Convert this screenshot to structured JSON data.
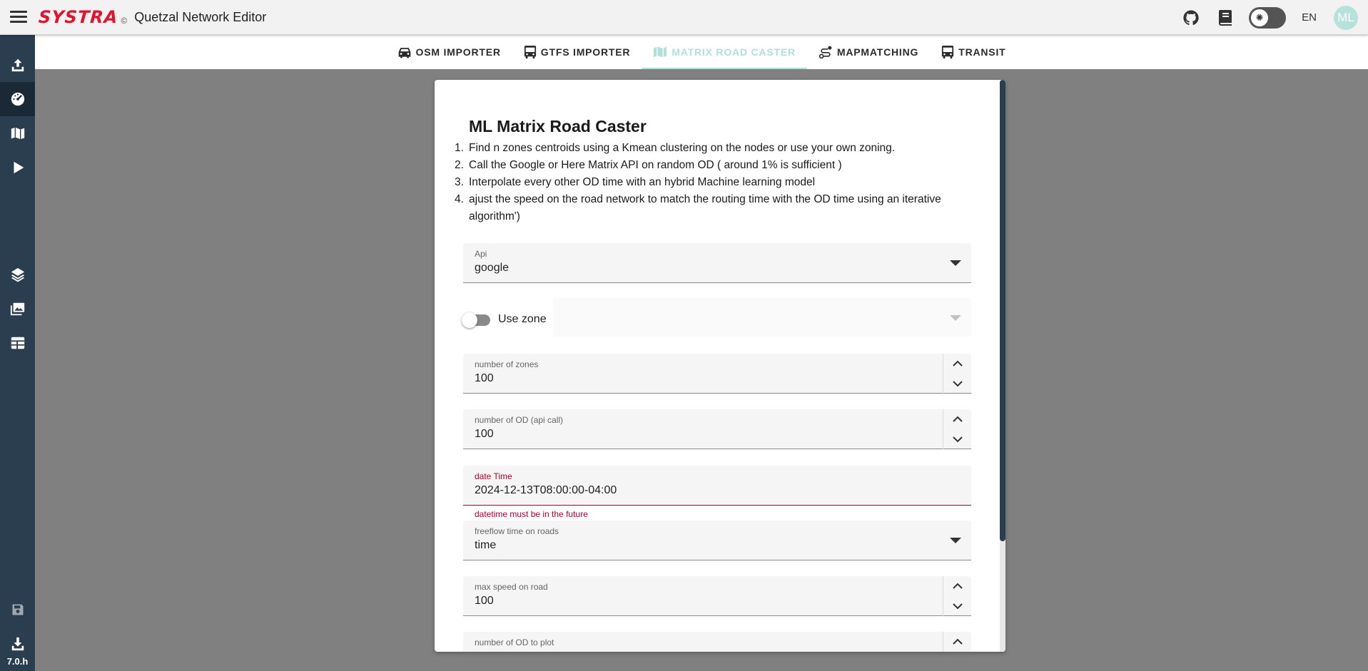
{
  "appbar": {
    "brand": "SYSTRA",
    "copyright": "©",
    "title": "Quetzal Network Editor",
    "language": "EN",
    "avatar_initials": "ML"
  },
  "sidebar": {
    "items": [
      {
        "icon": "upload-icon"
      },
      {
        "icon": "speedometer-icon",
        "active": true
      },
      {
        "icon": "map-icon"
      },
      {
        "icon": "play-icon"
      },
      {
        "icon": "layers-icon"
      },
      {
        "icon": "images-icon"
      },
      {
        "icon": "table-icon"
      },
      {
        "icon": "save-icon",
        "disabled": true
      },
      {
        "icon": "download-icon"
      }
    ],
    "version": "7.0.h"
  },
  "tabs": [
    {
      "label": "OSM IMPORTER",
      "icon": "car-icon"
    },
    {
      "label": "GTFS IMPORTER",
      "icon": "bus-icon"
    },
    {
      "label": "MATRIX ROAD CASTER",
      "icon": "map-icon",
      "active": true
    },
    {
      "label": "MAPMATCHING",
      "icon": "route-icon"
    },
    {
      "label": "TRANSIT",
      "icon": "bus-icon"
    }
  ],
  "card": {
    "title": "ML Matrix Road Caster",
    "steps": [
      {
        "num": "1.",
        "text": "Find n zones centroids using a Kmean clustering on the nodes or use your own zoning."
      },
      {
        "num": "2.",
        "text": "Call the Google or Here Matrix API on random OD ( around 1% is sufficient )"
      },
      {
        "num": "3.",
        "text": "Interpolate every other OD time with an hybrid Machine learning model"
      },
      {
        "num": "4.",
        "text": "ajust the speed on the road network to match the routing time with the OD time using an iterative algorithm')"
      }
    ],
    "api": {
      "label": "Api",
      "value": "google"
    },
    "use_zone": {
      "label": "Use zone",
      "enabled": false
    },
    "number_of_zones": {
      "label": "number of zones",
      "value": "100"
    },
    "number_of_od": {
      "label": "number of OD (api call)",
      "value": "100"
    },
    "date_time": {
      "label": "date Time",
      "value": "2024-12-13T08:00:00-04:00",
      "error": "datetime must be in the future"
    },
    "freeflow": {
      "label": "freeflow time on roads",
      "value": "time"
    },
    "max_speed": {
      "label": "max speed on road",
      "value": "100"
    },
    "od_to_plot": {
      "label": "number of OD to plot"
    }
  },
  "colors": {
    "brand_red": "#e0142f",
    "sidebar": "#2b3e50",
    "active_tab": "#b2dfd9",
    "error": "#b0002a",
    "avatar": "#b7e2dc"
  }
}
